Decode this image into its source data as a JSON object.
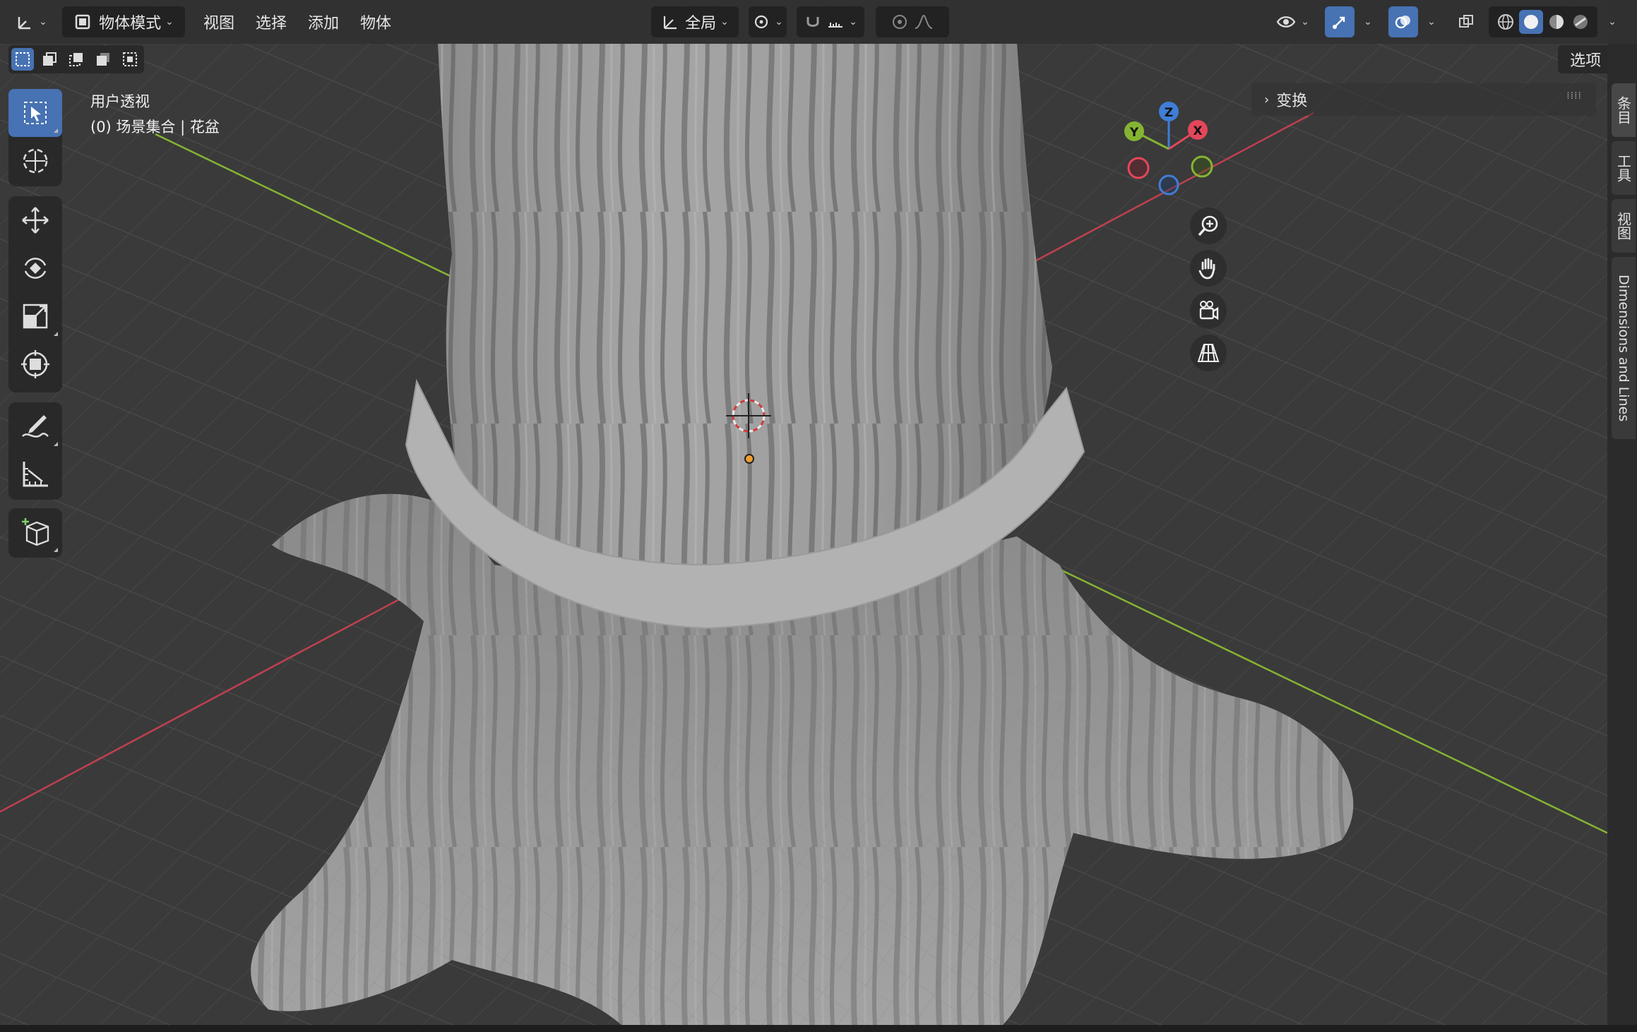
{
  "header": {
    "editor_type_icon": "cube-axes-icon",
    "mode_label": "物体模式",
    "menus": [
      "视图",
      "选择",
      "添加",
      "物体"
    ],
    "transform_orientation_label": "全局",
    "options_label": "选项"
  },
  "viewport": {
    "view_name": "用户透视",
    "collection_path": "(0) 场景集合 | 花盆",
    "sidebar_panel_label": "变换",
    "gizmo_axes": {
      "x": "X",
      "y": "Y",
      "z": "Z"
    }
  },
  "tools": [
    {
      "name": "select-box-tool",
      "icon": "cursor-box-icon",
      "active": true
    },
    {
      "name": "cursor-tool",
      "icon": "crosshair-circle-icon"
    },
    {
      "name": "move-tool",
      "icon": "move-arrows-icon"
    },
    {
      "name": "rotate-tool",
      "icon": "rotate-icon"
    },
    {
      "name": "scale-tool",
      "icon": "scale-icon"
    },
    {
      "name": "transform-tool",
      "icon": "transform-icon"
    },
    {
      "name": "annotate-tool",
      "icon": "annotate-pencil-icon"
    },
    {
      "name": "measure-tool",
      "icon": "ruler-icon"
    },
    {
      "name": "add-cube-tool",
      "icon": "add-cube-icon"
    }
  ],
  "nav_gizmo_buttons": [
    "zoom-icon",
    "hand-icon",
    "camera-icon",
    "grid-perspective-icon"
  ],
  "sidebar_tabs": [
    "条目",
    "工具",
    "视图",
    "Dimensions and Lines"
  ],
  "colors": {
    "accent": "#4772b3",
    "axis_x": "#e3475b",
    "axis_y": "#85b433",
    "axis_z": "#3f7ed6",
    "viewport_bg": "#3a3a3a",
    "header_bg": "#303030"
  }
}
